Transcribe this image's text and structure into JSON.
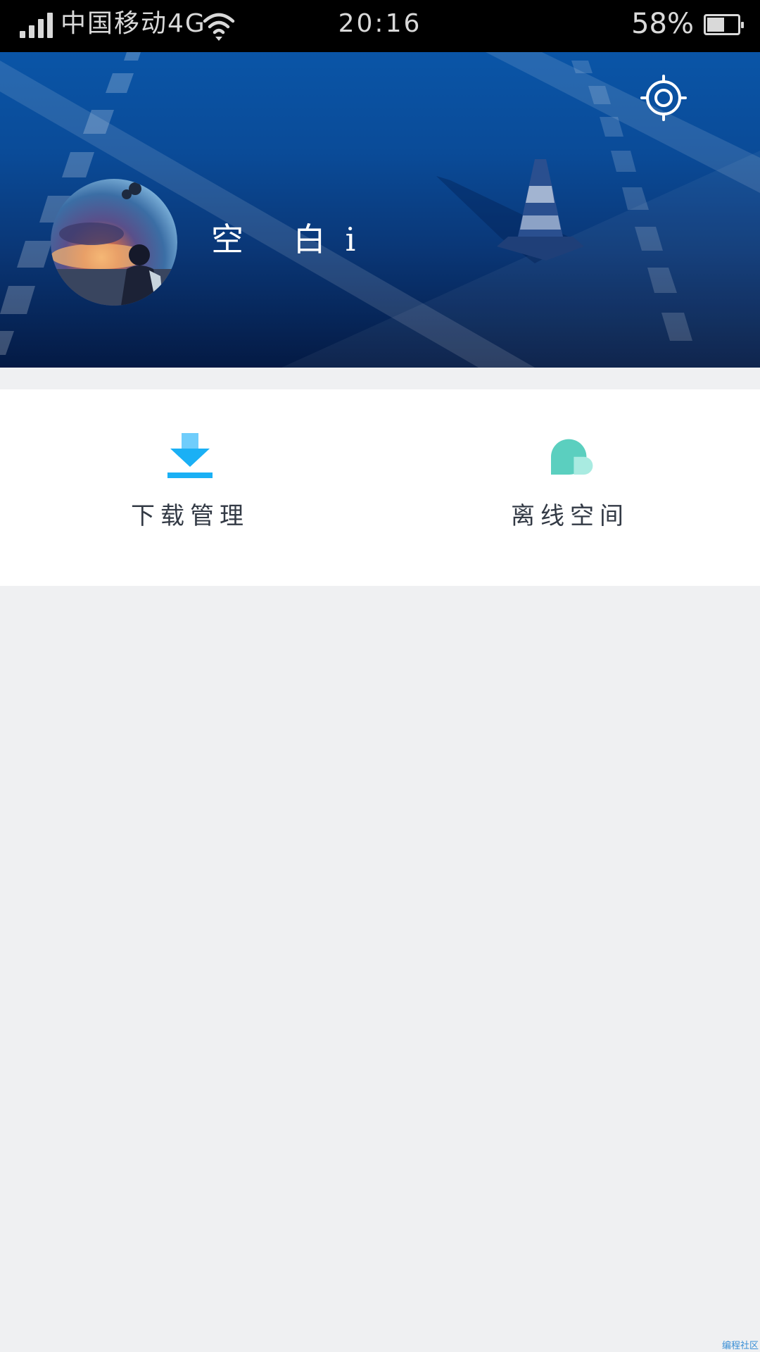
{
  "status_bar": {
    "carrier": "中国移动4G",
    "time": "20:16",
    "battery_percent": "58%",
    "battery_level": 0.58,
    "icons": [
      "signal-icon",
      "wifi-icon",
      "battery-icon"
    ]
  },
  "header": {
    "username": "空 白i",
    "settings_icon": "settings-gear-icon",
    "colors": {
      "background_top": "#0a55a7",
      "background_bottom": "#041a44"
    }
  },
  "shortcuts": [
    {
      "label": "下载管理",
      "icon": "download-icon",
      "color": "#1ab0f5"
    },
    {
      "label": "离线空间",
      "icon": "cloud-icon",
      "color": "#5bcfbf"
    }
  ],
  "watermark": "编程社区"
}
